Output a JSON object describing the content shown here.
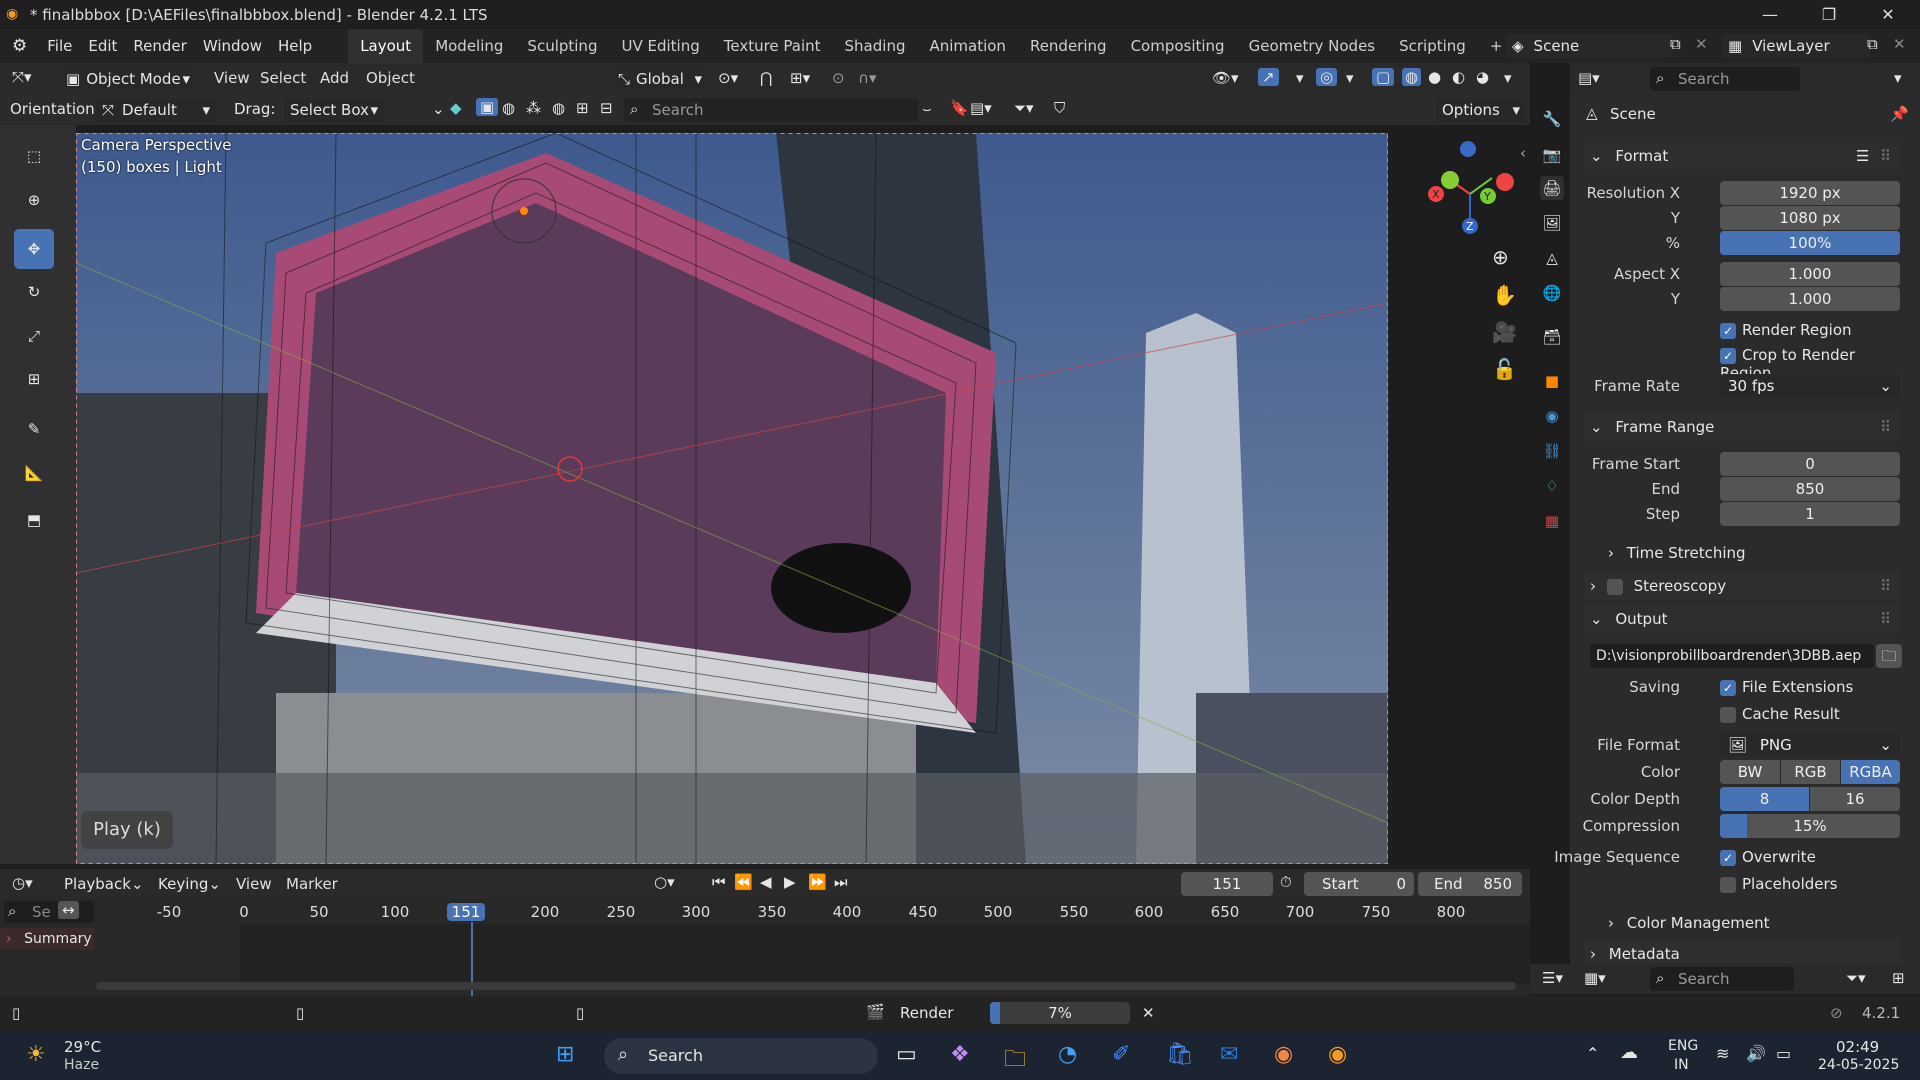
{
  "window": {
    "title": "* finalbbbox [D:\\AEFiles\\finalbbbox.blend] - Blender 4.2.1 LTS"
  },
  "menu": {
    "items": [
      "File",
      "Edit",
      "Render",
      "Window",
      "Help"
    ]
  },
  "workspaces": [
    "Layout",
    "Modeling",
    "Sculpting",
    "UV Editing",
    "Texture Paint",
    "Shading",
    "Animation",
    "Rendering",
    "Compositing",
    "Geometry Nodes",
    "Scripting"
  ],
  "scene": {
    "name": "Scene",
    "view_layer": "ViewLayer"
  },
  "viewport_header": {
    "mode": "Object Mode",
    "menus": [
      "View",
      "Select",
      "Add",
      "Object"
    ],
    "transform": "Global"
  },
  "tool_header": {
    "orientation_label": "Orientation:",
    "orientation": "Default",
    "drag_label": "Drag:",
    "drag": "Select Box",
    "search_placeholder": "Search",
    "options": "Options"
  },
  "viewport": {
    "camera_label": "Camera Perspective",
    "info": "(150) boxes | Light",
    "play_hint": "Play (k)"
  },
  "properties": {
    "search_placeholder": "Search",
    "scene_label": "Scene",
    "format": {
      "title": "Format",
      "res_x_label": "Resolution X",
      "res_x": "1920 px",
      "res_y_label": "Y",
      "res_y": "1080 px",
      "pct_label": "%",
      "pct": "100%",
      "pct_value": 1.0,
      "aspect_x_label": "Aspect X",
      "aspect_x": "1.000",
      "aspect_y_label": "Y",
      "aspect_y": "1.000",
      "render_region": "Render Region",
      "crop": "Crop to Render Region",
      "frame_rate_label": "Frame Rate",
      "frame_rate": "30 fps"
    },
    "frame_range": {
      "title": "Frame Range",
      "start_label": "Frame Start",
      "start": "0",
      "end_label": "End",
      "end": "850",
      "step_label": "Step",
      "step": "1"
    },
    "time_stretching": "Time Stretching",
    "stereoscopy": "Stereoscopy",
    "output": {
      "title": "Output",
      "path": "D:\\visionprobillboardrender\\3DBB.aep",
      "saving_label": "Saving",
      "file_ext": "File Extensions",
      "cache": "Cache Result",
      "file_format_label": "File Format",
      "file_format": "PNG",
      "color_label": "Color",
      "colors": [
        "BW",
        "RGB",
        "RGBA"
      ],
      "color_depth_label": "Color Depth",
      "depths": [
        "8",
        "16"
      ],
      "compression_label": "Compression",
      "compression": "15%",
      "compression_value": 0.15,
      "image_seq_label": "Image Sequence",
      "overwrite": "Overwrite",
      "placeholders": "Placeholders"
    },
    "color_management": "Color Management",
    "metadata": "Metadata",
    "outliner_search": "Search"
  },
  "timeline": {
    "menus": [
      "Playback",
      "Keying",
      "View",
      "Marker"
    ],
    "current_frame": "151",
    "start_label": "Start",
    "start": "0",
    "end_label": "End",
    "end": "850",
    "ticks": [
      "-50",
      "0",
      "50",
      "100",
      "151",
      "200",
      "250",
      "300",
      "350",
      "400",
      "450",
      "500",
      "550",
      "600",
      "650",
      "700",
      "750",
      "800"
    ],
    "summary": "Summary",
    "search_placeholder": "Se"
  },
  "statusbar": {
    "render_label": "Render",
    "progress": "7%",
    "progress_value": 0.07,
    "version": "4.2.1"
  },
  "taskbar": {
    "weather_temp": "29°C",
    "weather_desc": "Haze",
    "search": "Search",
    "lang1": "ENG",
    "lang2": "IN",
    "time": "02:49",
    "date": "24-05-2025"
  },
  "colors": {
    "accent": "#4772b3",
    "frame_marker": "#4772b3"
  }
}
